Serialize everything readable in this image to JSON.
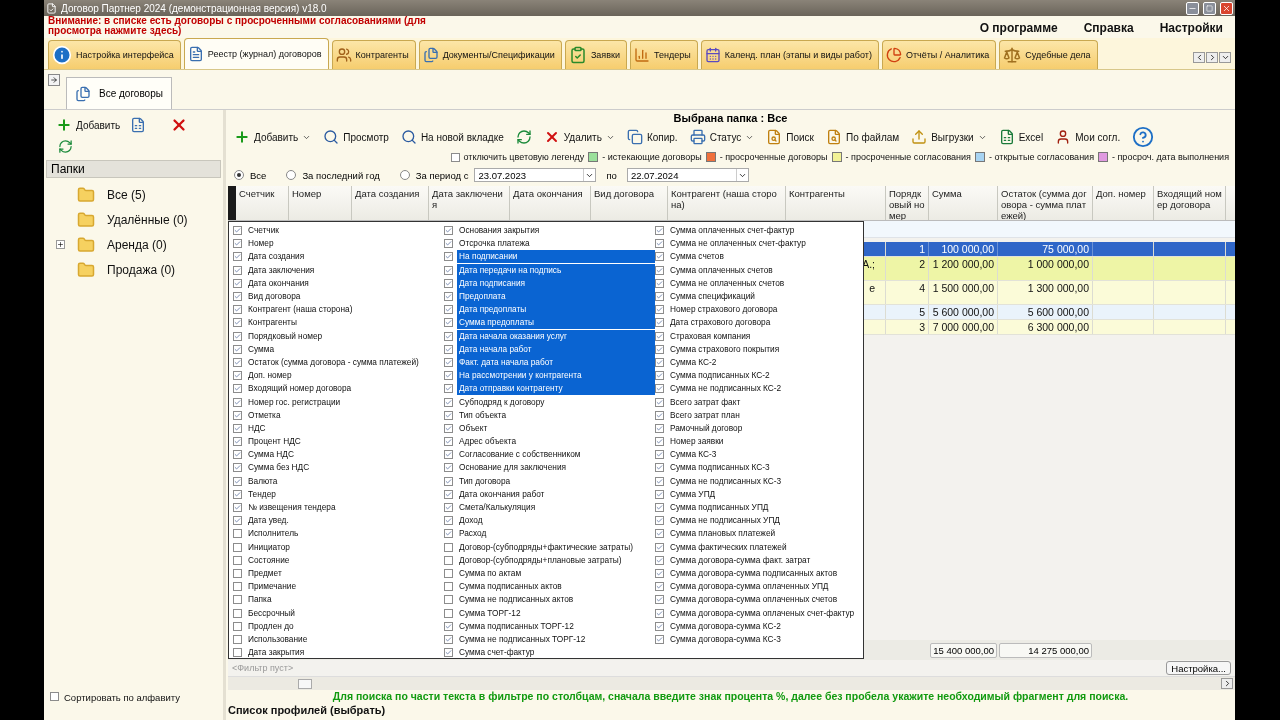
{
  "window": {
    "title": "Договор Партнер 2024 (демонстрационная версия) v18.0"
  },
  "warning": "Внимание: в списке есть договоры с просроченными согласованиями (для просмотра нажмите здесь)",
  "menu": [
    "О программе",
    "Справка",
    "Настройки"
  ],
  "tabs": [
    {
      "label": "Настройка интерфейса",
      "selected": false
    },
    {
      "label": "Реестр (журнал) договоров",
      "selected": true
    },
    {
      "label": "Контрагенты",
      "selected": false
    },
    {
      "label": "Документы/Спецификации",
      "selected": false
    },
    {
      "label": "Заявки",
      "selected": false
    },
    {
      "label": "Тендеры",
      "selected": false
    },
    {
      "label": "Календ. план (этапы и виды работ)",
      "selected": false
    },
    {
      "label": "Отчёты / Аналитика",
      "selected": false
    },
    {
      "label": "Судебные дела",
      "selected": false
    }
  ],
  "subtabs": [
    {
      "label": "Все договоры",
      "selected": true
    }
  ],
  "left_panel": {
    "add_label": "Добавить",
    "folders_header": "Папки",
    "folders": [
      {
        "label": "Все (5)",
        "expandable": false
      },
      {
        "label": "Удалённые (0)",
        "expandable": false
      },
      {
        "label": "Аренда (0)",
        "expandable": true
      },
      {
        "label": "Продажа (0)",
        "expandable": false
      }
    ],
    "sort": {
      "label": "Сортировать по алфавиту",
      "checked": false
    }
  },
  "folder_title": "Выбрана папка : Все",
  "toolbar": [
    {
      "kind": "button",
      "label": "Добавить",
      "dropdown": true
    },
    {
      "kind": "button",
      "label": "Просмотр",
      "dropdown": false
    },
    {
      "kind": "button",
      "label": "На новой вкладке",
      "dropdown": false
    },
    {
      "kind": "icon"
    },
    {
      "kind": "button",
      "label": "Удалить",
      "dropdown": true
    },
    {
      "kind": "button",
      "label": "Копир.",
      "dropdown": false
    },
    {
      "kind": "button",
      "label": "Статус",
      "dropdown": true
    },
    {
      "kind": "button",
      "label": "Поиск",
      "dropdown": false
    },
    {
      "kind": "button",
      "label": "По файлам",
      "dropdown": false
    },
    {
      "kind": "button",
      "label": "Выгрузки",
      "dropdown": true
    },
    {
      "kind": "button",
      "label": "Excel",
      "dropdown": false
    },
    {
      "kind": "button",
      "label": "Мои согл.",
      "dropdown": false
    },
    {
      "kind": "icon"
    }
  ],
  "legend": {
    "disable": {
      "label": "отключить цветовую легенду",
      "checked": false
    },
    "items": [
      {
        "label": "- истекающие договоры",
        "color": "#9be09b"
      },
      {
        "label": "- просроченные договоры",
        "color": "#f0703c"
      },
      {
        "label": "- просроченные согласования",
        "color": "#f2f296"
      },
      {
        "label": "- открытые согласования",
        "color": "#a8d4f2"
      },
      {
        "label": "- просроч. дата выполнения",
        "color": "#e09ae0"
      }
    ]
  },
  "period": {
    "options": [
      {
        "label": "Все",
        "selected": true
      },
      {
        "label": "За последний год",
        "selected": false
      },
      {
        "label": "За период с",
        "selected": false
      }
    ],
    "from": "23.07.2023",
    "to_label": "по",
    "to": "22.07.2024"
  },
  "table": {
    "columns": [
      "Счетчик",
      "Номер",
      "Дата создания",
      "Дата заключения",
      "Дата окончания",
      "Вид договора",
      "Контрагент (наша сторона)",
      "Контрагенты",
      "Порядковый номер",
      "Сумма",
      "Остаток (сумма договора - сумма платежей)",
      "Доп. номер",
      "Входящий номер договора"
    ],
    "rows": [
      {
        "selected": true,
        "order": "1",
        "sum": "100 000,00",
        "rest": "75 000,00"
      },
      {
        "selected": false,
        "color": "#eef5a6",
        "contragents": "А.;",
        "order": "2",
        "sum": "1 200 000,00",
        "rest": "1 000 000,00"
      },
      {
        "selected": false,
        "color": "#fbfbd8",
        "contragents": "е",
        "order": "4",
        "sum": "1 500 000,00",
        "rest": "1 300 000,00"
      },
      {
        "selected": false,
        "color": "#eaf3fb",
        "order": "5",
        "sum": "5 600 000,00",
        "rest": "5 600 000,00"
      },
      {
        "selected": false,
        "color": "#fbfbd8",
        "order": "3",
        "sum": "7 000 000,00",
        "rest": "6 300 000,00"
      }
    ],
    "totals": {
      "sum": "15 400 000,00",
      "rest": "14 275 000,00"
    },
    "filter_status": "<Фильтр пуст>",
    "settings_button": "Настройка..."
  },
  "column_chooser": [
    [
      {
        "label": "Счетчик",
        "checked": true,
        "selected": false
      },
      {
        "label": "Номер",
        "checked": true,
        "selected": false
      },
      {
        "label": "Дата создания",
        "checked": true,
        "selected": false
      },
      {
        "label": "Дата заключения",
        "checked": true,
        "selected": false
      },
      {
        "label": "Дата окончания",
        "checked": true,
        "selected": false
      },
      {
        "label": "Вид договора",
        "checked": true,
        "selected": false
      },
      {
        "label": "Контрагент (наша сторона)",
        "checked": true,
        "selected": false
      },
      {
        "label": "Контрагенты",
        "checked": true,
        "selected": false
      },
      {
        "label": "Порядковый номер",
        "checked": true,
        "selected": false
      },
      {
        "label": "Сумма",
        "checked": true,
        "selected": false
      },
      {
        "label": "Остаток (сумма договора - сумма платежей)",
        "checked": true,
        "selected": false
      },
      {
        "label": "Доп. номер",
        "checked": true,
        "selected": false
      },
      {
        "label": "Входящий номер договора",
        "checked": true,
        "selected": false
      },
      {
        "label": "Номер гос. регистрации",
        "checked": true,
        "selected": false
      },
      {
        "label": "Отметка",
        "checked": true,
        "selected": false
      },
      {
        "label": "НДС",
        "checked": true,
        "selected": false
      },
      {
        "label": "Процент НДС",
        "checked": true,
        "selected": false
      },
      {
        "label": "Сумма НДС",
        "checked": true,
        "selected": false
      },
      {
        "label": "Сумма без НДС",
        "checked": true,
        "selected": false
      },
      {
        "label": "Валюта",
        "checked": true,
        "selected": false
      },
      {
        "label": "Тендер",
        "checked": true,
        "selected": false
      },
      {
        "label": "№ извещения тендера",
        "checked": true,
        "selected": false
      },
      {
        "label": "Дата увед.",
        "checked": true,
        "selected": false
      },
      {
        "label": "Исполнитель",
        "checked": false,
        "selected": false
      },
      {
        "label": "Инициатор",
        "checked": false,
        "selected": false
      },
      {
        "label": "Состояние",
        "checked": false,
        "selected": false
      },
      {
        "label": "Предмет",
        "checked": false,
        "selected": false
      },
      {
        "label": "Примечание",
        "checked": false,
        "selected": false
      },
      {
        "label": "Папка",
        "checked": false,
        "selected": false
      },
      {
        "label": "Бессрочный",
        "checked": false,
        "selected": false
      },
      {
        "label": "Продлен до",
        "checked": false,
        "selected": false
      },
      {
        "label": "Использование",
        "checked": false,
        "selected": false
      },
      {
        "label": "Дата закрытия",
        "checked": false,
        "selected": false
      }
    ],
    [
      {
        "label": "Основания закрытия",
        "checked": true,
        "selected": false
      },
      {
        "label": "Отсрочка платежа",
        "checked": true,
        "selected": false
      },
      {
        "label": "На подписании",
        "checked": true,
        "selected": true
      },
      {
        "label": "Дата передачи на подпись",
        "checked": true,
        "selected": true
      },
      {
        "label": "Дата подписания",
        "checked": true,
        "selected": true
      },
      {
        "label": "Предоплата",
        "checked": true,
        "selected": true
      },
      {
        "label": "Дата предоплаты",
        "checked": true,
        "selected": true
      },
      {
        "label": "Сумма предоплаты",
        "checked": true,
        "selected": true
      },
      {
        "label": "Дата начала оказания услуг",
        "checked": true,
        "selected": true
      },
      {
        "label": "Дата начала работ",
        "checked": true,
        "selected": true
      },
      {
        "label": "Факт. дата начала работ",
        "checked": true,
        "selected": true
      },
      {
        "label": "На рассмотрении у контрагента",
        "checked": true,
        "selected": true
      },
      {
        "label": "Дата отправки контрагенту",
        "checked": true,
        "selected": true
      },
      {
        "label": "Субподряд к договору",
        "checked": true,
        "selected": false
      },
      {
        "label": "Тип объекта",
        "checked": true,
        "selected": false
      },
      {
        "label": "Объект",
        "checked": true,
        "selected": false
      },
      {
        "label": "Адрес объекта",
        "checked": true,
        "selected": false
      },
      {
        "label": "Согласование с собственником",
        "checked": true,
        "selected": false
      },
      {
        "label": "Основание для заключения",
        "checked": true,
        "selected": false
      },
      {
        "label": "Тип договора",
        "checked": true,
        "selected": false
      },
      {
        "label": "Дата окончания работ",
        "checked": true,
        "selected": false
      },
      {
        "label": "Смета/Калькуляция",
        "checked": true,
        "selected": false
      },
      {
        "label": "Доход",
        "checked": true,
        "selected": false
      },
      {
        "label": "Расход",
        "checked": true,
        "selected": false
      },
      {
        "label": "Договор-(субподряды+фактические затраты)",
        "checked": false,
        "selected": false
      },
      {
        "label": "Договор-(субподряды+плановые затраты)",
        "checked": false,
        "selected": false
      },
      {
        "label": "Сумма по актам",
        "checked": false,
        "selected": false
      },
      {
        "label": "Сумма подписанных актов",
        "checked": false,
        "selected": false
      },
      {
        "label": "Сумма не подписанных актов",
        "checked": false,
        "selected": false
      },
      {
        "label": "Сумма ТОРГ-12",
        "checked": false,
        "selected": false
      },
      {
        "label": "Сумма подписанных ТОРГ-12",
        "checked": true,
        "selected": false
      },
      {
        "label": "Сумма не подписанных ТОРГ-12",
        "checked": true,
        "selected": false
      },
      {
        "label": "Сумма счет-фактур",
        "checked": true,
        "selected": false
      }
    ],
    [
      {
        "label": "Сумма оплаченных счет-фактур",
        "checked": true,
        "selected": false
      },
      {
        "label": "Сумма не оплаченных счет-фактур",
        "checked": true,
        "selected": false
      },
      {
        "label": "Сумма счетов",
        "checked": true,
        "selected": false
      },
      {
        "label": "Сумма оплаченных счетов",
        "checked": true,
        "selected": false
      },
      {
        "label": "Сумма не оплаченных счетов",
        "checked": true,
        "selected": false
      },
      {
        "label": "Сумма спецификаций",
        "checked": true,
        "selected": false
      },
      {
        "label": "Номер страхового договора",
        "checked": true,
        "selected": false
      },
      {
        "label": "Дата страхового договора",
        "checked": true,
        "selected": false
      },
      {
        "label": "Страховая компания",
        "checked": true,
        "selected": false
      },
      {
        "label": "Сумма страхового покрытия",
        "checked": true,
        "selected": false
      },
      {
        "label": "Сумма КС-2",
        "checked": true,
        "selected": false
      },
      {
        "label": "Сумма подписанных КС-2",
        "checked": true,
        "selected": false
      },
      {
        "label": "Сумма не подписанных КС-2",
        "checked": true,
        "selected": false
      },
      {
        "label": "Всего затрат факт",
        "checked": true,
        "selected": false
      },
      {
        "label": "Всего затрат план",
        "checked": true,
        "selected": false
      },
      {
        "label": "Рамочный договор",
        "checked": true,
        "selected": false
      },
      {
        "label": "Номер заявки",
        "checked": true,
        "selected": false
      },
      {
        "label": "Сумма КС-3",
        "checked": true,
        "selected": false
      },
      {
        "label": "Сумма подписанных КС-3",
        "checked": true,
        "selected": false
      },
      {
        "label": "Сумма не подписанных КС-3",
        "checked": true,
        "selected": false
      },
      {
        "label": "Сумма УПД",
        "checked": true,
        "selected": false
      },
      {
        "label": "Сумма подписанных УПД",
        "checked": true,
        "selected": false
      },
      {
        "label": "Сумма не подписанных УПД",
        "checked": true,
        "selected": false
      },
      {
        "label": "Сумма плановых платежей",
        "checked": true,
        "selected": false
      },
      {
        "label": "Сумма фактических платежей",
        "checked": true,
        "selected": false
      },
      {
        "label": "Сумма договора-сумма факт. затрат",
        "checked": true,
        "selected": false
      },
      {
        "label": "Сумма договора-сумма подписанных актов",
        "checked": true,
        "selected": false
      },
      {
        "label": "Сумма договора-сумма оплаченных УПД",
        "checked": true,
        "selected": false
      },
      {
        "label": "Сумма договора-сумма оплаченных счетов",
        "checked": true,
        "selected": false
      },
      {
        "label": "Сумма договора-сумма оплаченых счет-фактур",
        "checked": true,
        "selected": false
      },
      {
        "label": "Сумма договора-сумма КС-2",
        "checked": true,
        "selected": false
      },
      {
        "label": "Сумма договора-сумма КС-3",
        "checked": true,
        "selected": false
      }
    ]
  ],
  "hint": "Для поиска по части текста в фильтре по столбцам, сначала введите знак процента %, далее без пробела укажите необходимый фрагмент для поиска.",
  "profiles": "Список профилей (выбрать)"
}
